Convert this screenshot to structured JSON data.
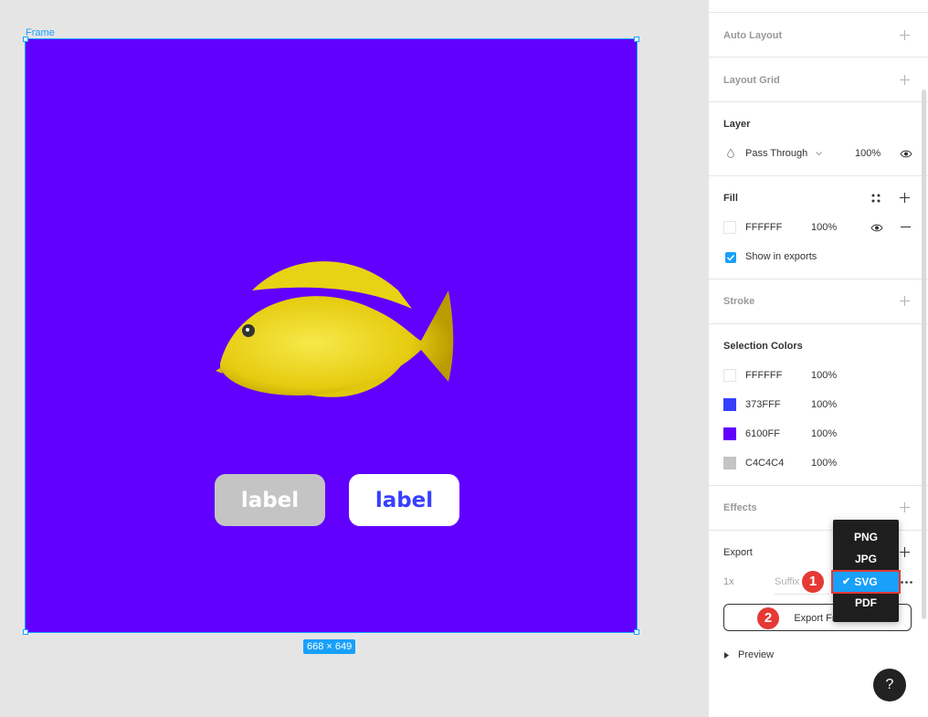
{
  "canvas": {
    "frame_label": "Frame",
    "frame_size": "668 × 649",
    "frame_color": "#6100ff",
    "buttons": [
      {
        "label": "label",
        "bg": "#c4c4c4",
        "color": "#ffffff"
      },
      {
        "label": "label",
        "bg": "#ffffff",
        "color": "#373fff"
      }
    ]
  },
  "panel": {
    "auto_layout": "Auto Layout",
    "layout_grid": "Layout Grid",
    "layer": {
      "title": "Layer",
      "blend": "Pass Through",
      "opacity": "100%"
    },
    "fill": {
      "title": "Fill",
      "hex": "FFFFFF",
      "opacity": "100%",
      "show_in_exports": "Show in exports"
    },
    "stroke": "Stroke",
    "selection_colors": {
      "title": "Selection Colors",
      "items": [
        {
          "hex": "FFFFFF",
          "opacity": "100%",
          "color": "#ffffff"
        },
        {
          "hex": "373FFF",
          "opacity": "100%",
          "color": "#373fff"
        },
        {
          "hex": "6100FF",
          "opacity": "100%",
          "color": "#6100ff"
        },
        {
          "hex": "C4C4C4",
          "opacity": "100%",
          "color": "#c4c4c4"
        }
      ]
    },
    "effects": "Effects",
    "export": {
      "title": "Export",
      "scale": "1x",
      "suffix_placeholder": "Suffix",
      "button": "Export Fra",
      "preview": "Preview",
      "formats": [
        "PNG",
        "JPG",
        "SVG",
        "PDF"
      ],
      "selected_format": "SVG"
    }
  },
  "markers": [
    "1",
    "2"
  ],
  "help": "?"
}
